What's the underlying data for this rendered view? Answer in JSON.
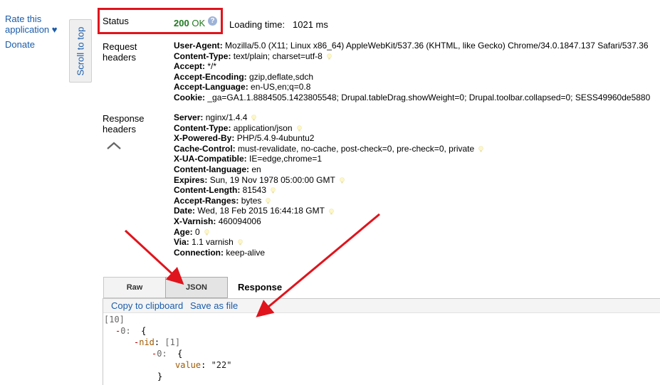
{
  "sidebar": {
    "rate_label": "Rate this application ♥",
    "donate_label": "Donate"
  },
  "scroll_top_label": "Scroll to top",
  "status": {
    "label": "Status",
    "code": "200",
    "text": "OK",
    "help_icon": "question-icon",
    "loading_label": "Loading time:",
    "loading_value": "1021 ms"
  },
  "request": {
    "label_line1": "Request",
    "label_line2": "headers",
    "headers": [
      {
        "name": "User-Agent",
        "value": "Mozilla/5.0 (X11; Linux x86_64) AppleWebKit/537.36 (KHTML, like Gecko) Chrome/34.0.1847.137 Safari/537.36",
        "hint": false
      },
      {
        "name": "Content-Type",
        "value": "text/plain; charset=utf-8",
        "hint": true
      },
      {
        "name": "Accept",
        "value": "*/*",
        "hint": false
      },
      {
        "name": "Accept-Encoding",
        "value": "gzip,deflate,sdch",
        "hint": false
      },
      {
        "name": "Accept-Language",
        "value": "en-US,en;q=0.8",
        "hint": false
      },
      {
        "name": "Cookie",
        "value": "_ga=GA1.1.8884505.1423805548; Drupal.tableDrag.showWeight=0; Drupal.toolbar.collapsed=0; SESS49960de5880",
        "hint": false
      }
    ]
  },
  "response": {
    "label_line1": "Response",
    "label_line2": "headers",
    "collapse_icon": "chevron-up-icon",
    "headers": [
      {
        "name": "Server",
        "value": "nginx/1.4.4",
        "hint": true
      },
      {
        "name": "Content-Type",
        "value": "application/json",
        "hint": true
      },
      {
        "name": "X-Powered-By",
        "value": "PHP/5.4.9-4ubuntu2",
        "hint": false
      },
      {
        "name": "Cache-Control",
        "value": "must-revalidate, no-cache, post-check=0, pre-check=0, private",
        "hint": true
      },
      {
        "name": "X-UA-Compatible",
        "value": "IE=edge,chrome=1",
        "hint": false
      },
      {
        "name": "Content-language",
        "value": "en",
        "hint": false
      },
      {
        "name": "Expires",
        "value": "Sun, 19 Nov 1978 05:00:00 GMT",
        "hint": true
      },
      {
        "name": "Content-Length",
        "value": "81543",
        "hint": true
      },
      {
        "name": "Accept-Ranges",
        "value": "bytes",
        "hint": true
      },
      {
        "name": "Date",
        "value": "Wed, 18 Feb 2015 16:44:18 GMT",
        "hint": true
      },
      {
        "name": "X-Varnish",
        "value": "460094006",
        "hint": false
      },
      {
        "name": "Age",
        "value": "0",
        "hint": true
      },
      {
        "name": "Via",
        "value": "1.1 varnish",
        "hint": true
      },
      {
        "name": "Connection",
        "value": "keep-alive",
        "hint": false
      }
    ]
  },
  "tabs": {
    "raw_label": "Raw",
    "json_label": "JSON",
    "response_title": "Response"
  },
  "body": {
    "copy_label": "Copy to clipboard",
    "save_label": "Save as file",
    "array_count": "[10]",
    "idx0": "0:",
    "open_brace": "{",
    "nid_key": "nid",
    "nid_count": "[1]",
    "inner_idx0": "0:",
    "inner_open": "{",
    "value_key": "value",
    "value_str": "\"22\"",
    "close_brace": "}"
  },
  "colors": {
    "highlight": "#e0141c",
    "status_ok": "#1f7a1f",
    "link": "#1a5cab"
  }
}
